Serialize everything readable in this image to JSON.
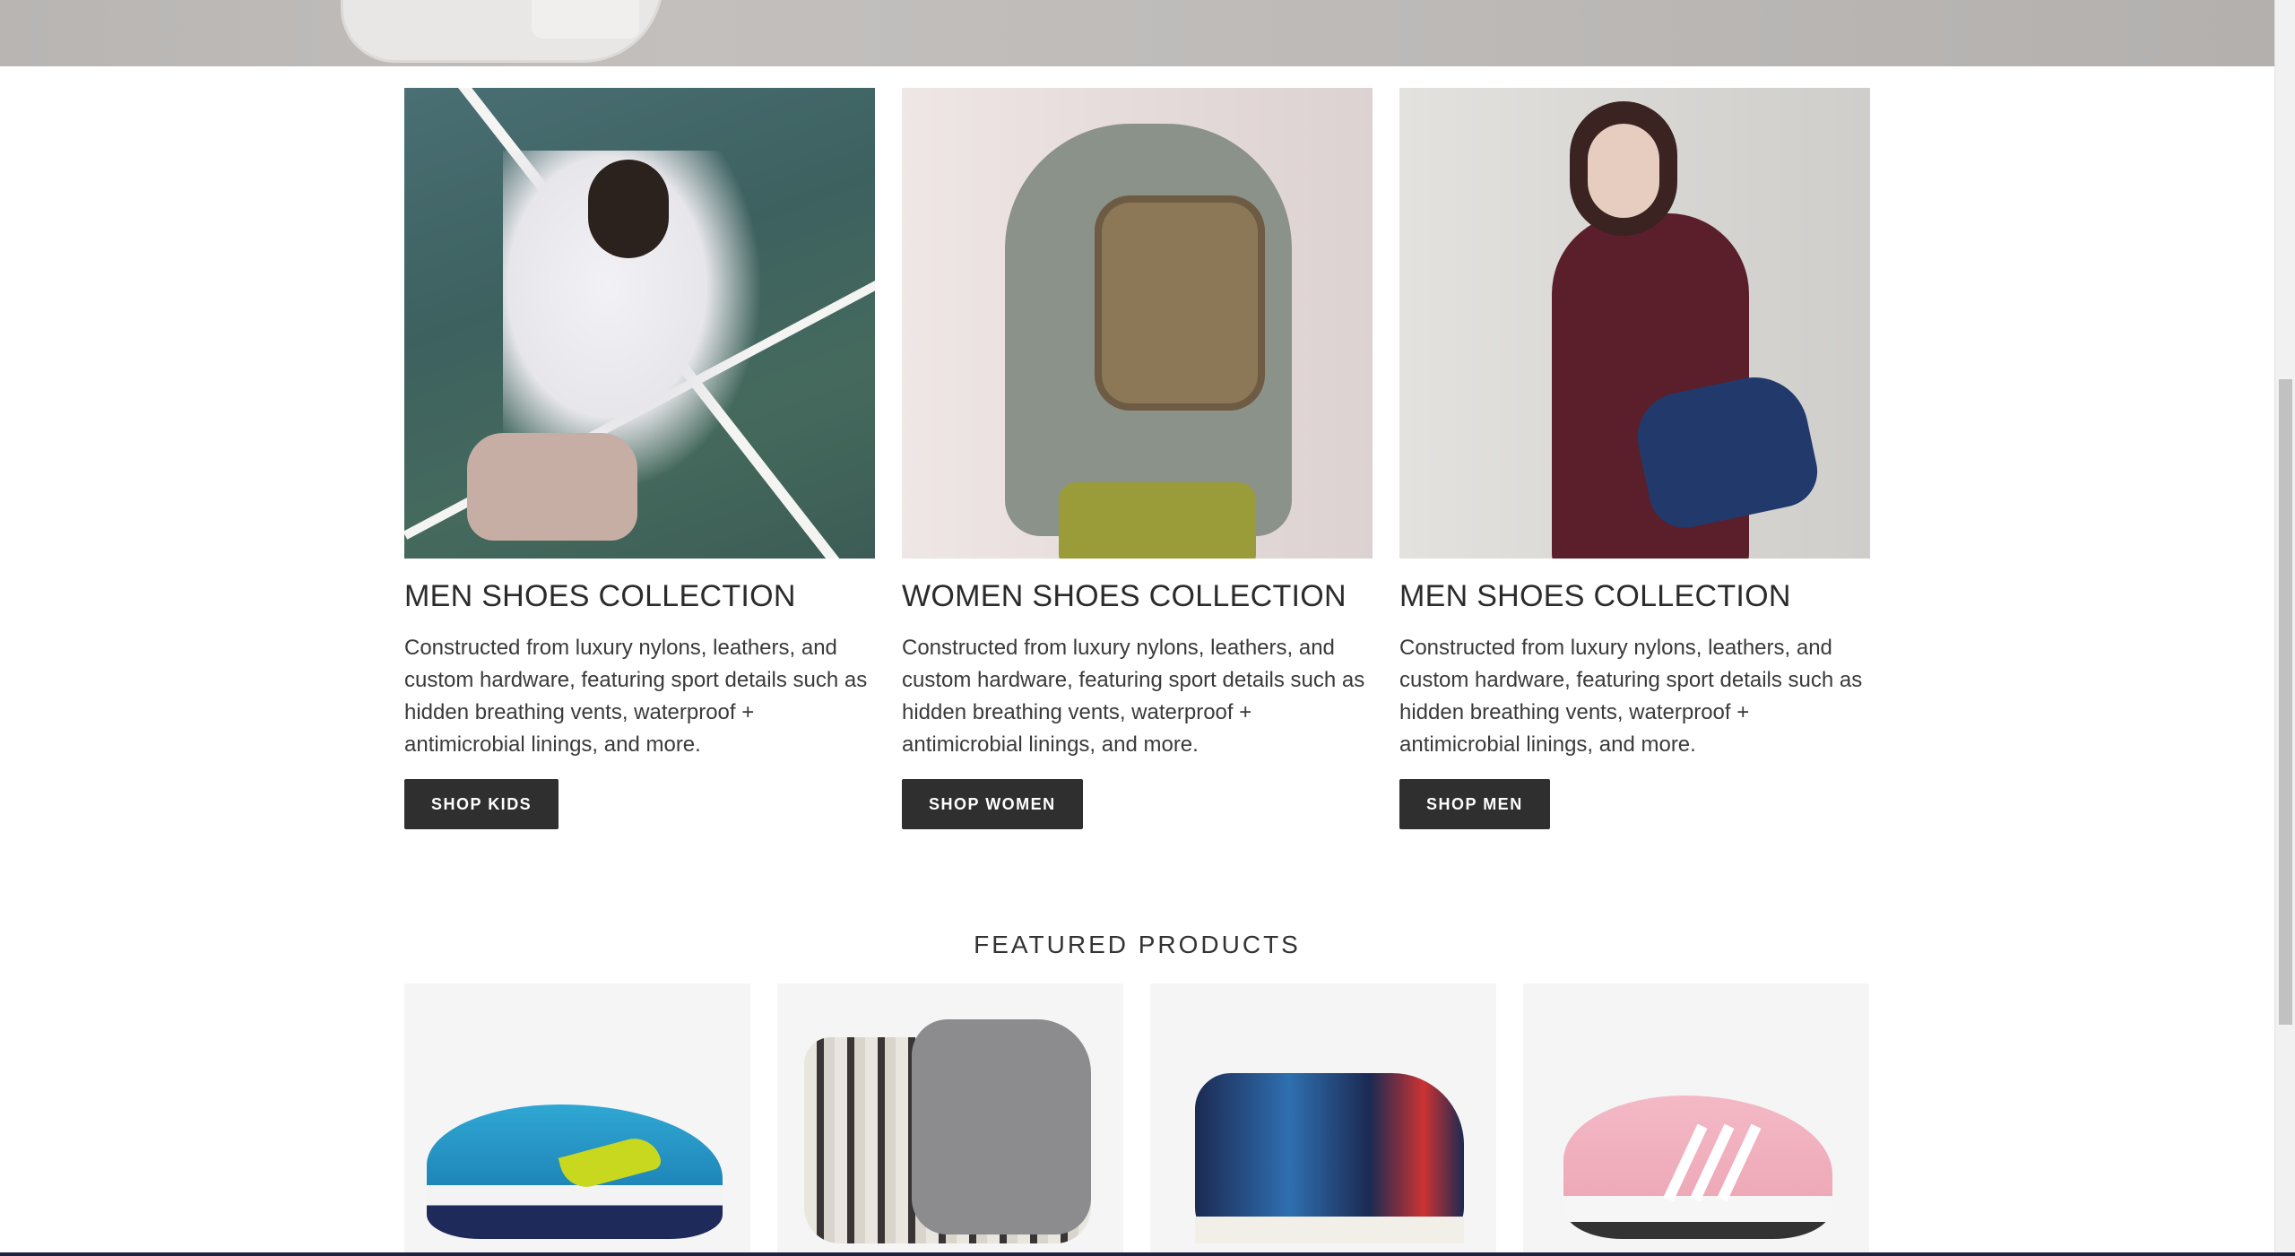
{
  "collections": [
    {
      "title": "MEN SHOES COLLECTION",
      "description": "Constructed from luxury nylons, leathers, and custom hardware, featuring sport details such as hidden breathing vents, waterproof + antimicrobial linings, and more.",
      "button": "SHOP KIDS"
    },
    {
      "title": "WOMEN SHOES COLLECTION",
      "description": "Constructed from luxury nylons, leathers, and custom hardware, featuring sport details such as hidden breathing vents, waterproof + antimicrobial linings, and more.",
      "button": "SHOP WOMEN"
    },
    {
      "title": "MEN SHOES COLLECTION",
      "description": "Constructed from luxury nylons, leathers, and custom hardware, featuring sport details such as hidden breathing vents, waterproof + antimicrobial linings, and more.",
      "button": "SHOP MEN"
    }
  ],
  "featured": {
    "heading": "FEATURED PRODUCTS"
  },
  "colors": {
    "button_bg": "#2f2f2f",
    "button_text": "#ffffff",
    "card_bg": "#f5f5f5"
  }
}
